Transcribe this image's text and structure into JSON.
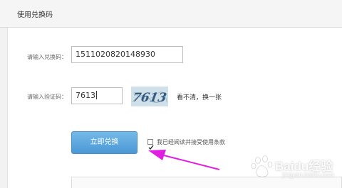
{
  "header": {
    "title": "使用兑换码"
  },
  "form": {
    "code_label": "请输入兑换码：",
    "code_value": "1511020820148930",
    "captcha_label": "请输入验证码：",
    "captcha_value": "7613",
    "captcha_image_text": "7613",
    "refresh_text": "看不清，换一张",
    "submit_label": "立即兑换",
    "agree_checked": true,
    "agree_text": "我已经阅读并接受使用条款"
  },
  "annotation": {
    "arrow_color": "#e020e0"
  },
  "watermark": {
    "brand": "Baidu经验",
    "sub": "jingyan.baidu.com"
  },
  "colors": {
    "accent": "#4b98d6"
  }
}
